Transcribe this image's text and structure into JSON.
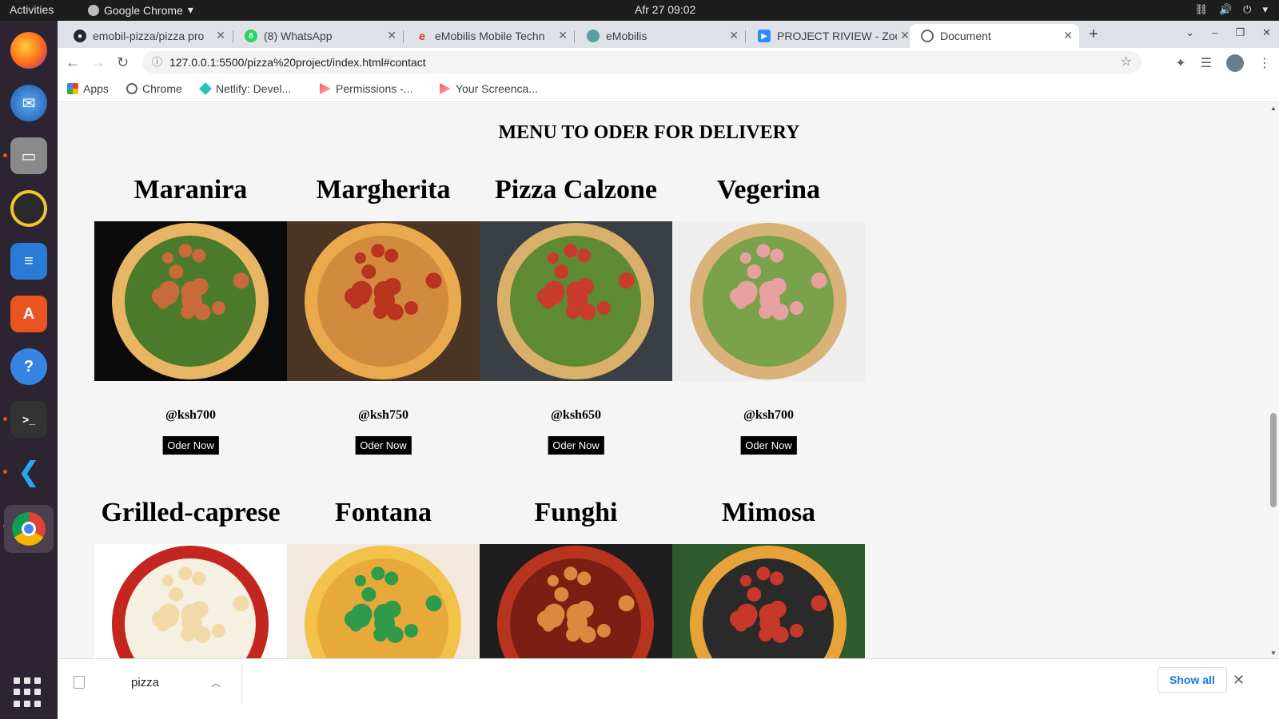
{
  "topbar": {
    "activities": "Activities",
    "app_name": "Google Chrome",
    "clock": "Afr 27  09:02"
  },
  "dock": {
    "apps": [
      "firefox-icon",
      "thunderbird-icon",
      "files-icon",
      "rhythmbox-icon",
      "writer-icon",
      "software-icon",
      "help-icon",
      "terminal-icon",
      "vscode-icon",
      "chrome-icon"
    ]
  },
  "tabs": [
    {
      "title": "emobil-pizza/pizza pro",
      "favicon": "github-icon",
      "color": "#24292e"
    },
    {
      "title": "(8) WhatsApp",
      "favicon": "whatsapp-icon",
      "color": "#25d366"
    },
    {
      "title": "eMobilis Mobile Techn",
      "favicon": "emobilis-e-icon",
      "color": "#e02b2b"
    },
    {
      "title": "eMobilis",
      "favicon": "globe-icon",
      "color": "#5aa0a0"
    },
    {
      "title": "PROJECT RIVIEW - Zoo",
      "favicon": "zoom-icon",
      "color": "#2d8cff"
    },
    {
      "title": "Document",
      "favicon": "globe-icon",
      "color": "#5f6368",
      "active": true
    }
  ],
  "toolbar": {
    "url": "127.0.0.1:5500/pizza%20project/index.html#contact"
  },
  "bookmarks": [
    {
      "label": "Apps",
      "icon": "apps-grid-icon"
    },
    {
      "label": "Chrome",
      "icon": "chrome-icon"
    },
    {
      "label": "Netlify: Devel...",
      "icon": "netlify-icon"
    },
    {
      "label": "Permissions -...",
      "icon": "screencastify-icon"
    },
    {
      "label": "Your Screenca...",
      "icon": "screencastify-icon"
    }
  ],
  "page": {
    "section_title": "MENU TO ODER FOR DELIVERY",
    "pizzas": [
      {
        "name": "Maranira",
        "price": "@ksh700",
        "button": "Oder Now",
        "palette": [
          "#0b0b0b",
          "#e8b565",
          "#c96a3a",
          "#4b7a2a"
        ]
      },
      {
        "name": "Margherita",
        "price": "@ksh750",
        "button": "Oder Now",
        "palette": [
          "#4a3424",
          "#e9a94c",
          "#b8341e",
          "#d28a3e"
        ]
      },
      {
        "name": "Pizza Calzone",
        "price": "@ksh650",
        "button": "Oder Now",
        "palette": [
          "#3a3f45",
          "#d8b06a",
          "#c83a2a",
          "#5f8a34"
        ]
      },
      {
        "name": "Vegerina",
        "price": "@ksh700",
        "button": "Oder Now",
        "palette": [
          "#eeeeee",
          "#d9b27a",
          "#e7a1a0",
          "#7aa24a"
        ]
      },
      {
        "name": "Grilled-caprese",
        "price": "",
        "button": "",
        "palette": [
          "#ffffff",
          "#c2261e",
          "#f1d9a8",
          "#f6f0e2"
        ]
      },
      {
        "name": "Fontana",
        "price": "",
        "button": "",
        "palette": [
          "#f0e9dc",
          "#f2c24a",
          "#2f9a4a",
          "#e6a93a"
        ]
      },
      {
        "name": "Funghi",
        "price": "",
        "button": "",
        "palette": [
          "#1e1e1e",
          "#b8341e",
          "#d98a3e",
          "#7a1f12"
        ]
      },
      {
        "name": "Mimosa",
        "price": "",
        "button": "",
        "palette": [
          "#2e5a2e",
          "#e8a23a",
          "#c8382a",
          "#2a2a2a"
        ]
      }
    ]
  },
  "shelf": {
    "file_name": "pizza",
    "show_all": "Show all"
  }
}
